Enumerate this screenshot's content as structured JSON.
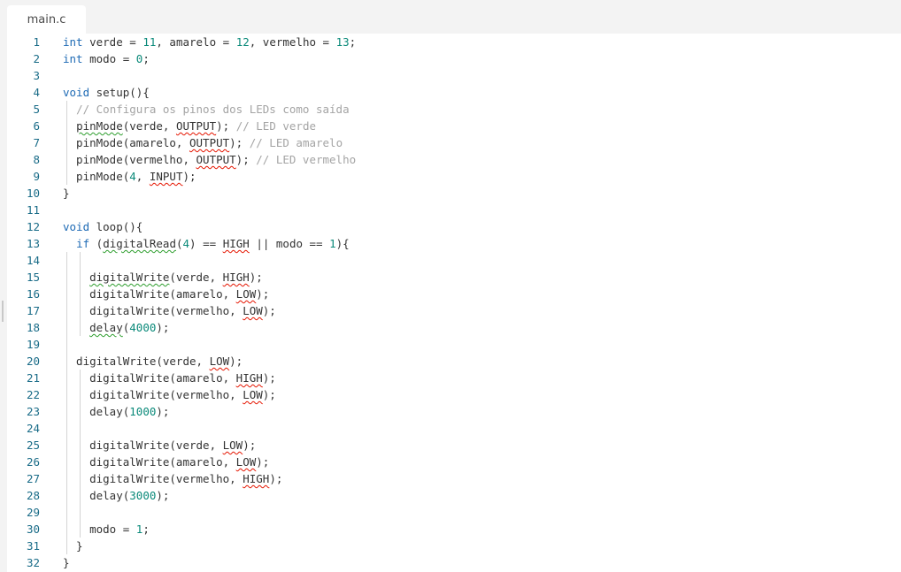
{
  "tab": {
    "label": "main.c"
  },
  "editor": {
    "lines": [
      {
        "n": "1",
        "tokens": [
          {
            "t": "int",
            "c": "kw"
          },
          {
            "t": " verde = "
          },
          {
            "t": "11",
            "c": "num"
          },
          {
            "t": ", amarelo = "
          },
          {
            "t": "12",
            "c": "num"
          },
          {
            "t": ", vermelho = "
          },
          {
            "t": "13",
            "c": "num"
          },
          {
            "t": ";"
          }
        ]
      },
      {
        "n": "2",
        "tokens": [
          {
            "t": "int",
            "c": "kw"
          },
          {
            "t": " modo = "
          },
          {
            "t": "0",
            "c": "num"
          },
          {
            "t": ";"
          }
        ]
      },
      {
        "n": "3",
        "tokens": []
      },
      {
        "n": "4",
        "tokens": [
          {
            "t": "void",
            "c": "kw"
          },
          {
            "t": " setup(){"
          }
        ]
      },
      {
        "n": "5",
        "tokens": [
          {
            "t": "  "
          },
          {
            "t": "// Configura os pinos dos LEDs como saída",
            "c": "cm"
          }
        ]
      },
      {
        "n": "6",
        "tokens": [
          {
            "t": "  "
          },
          {
            "t": "pinMode",
            "c": "sqg"
          },
          {
            "t": "(verde, "
          },
          {
            "t": "OUTPUT",
            "c": "sq"
          },
          {
            "t": "); "
          },
          {
            "t": "// LED verde",
            "c": "cm"
          }
        ]
      },
      {
        "n": "7",
        "tokens": [
          {
            "t": "  pinMode(amarelo, "
          },
          {
            "t": "OUTPUT",
            "c": "sq"
          },
          {
            "t": "); "
          },
          {
            "t": "// LED amarelo",
            "c": "cm"
          }
        ]
      },
      {
        "n": "8",
        "tokens": [
          {
            "t": "  pinMode(vermelho, "
          },
          {
            "t": "OUTPUT",
            "c": "sq"
          },
          {
            "t": "); "
          },
          {
            "t": "// LED vermelho",
            "c": "cm"
          }
        ]
      },
      {
        "n": "9",
        "tokens": [
          {
            "t": "  pinMode("
          },
          {
            "t": "4",
            "c": "num"
          },
          {
            "t": ", "
          },
          {
            "t": "INPUT",
            "c": "sq"
          },
          {
            "t": ");"
          }
        ]
      },
      {
        "n": "10",
        "tokens": [
          {
            "t": "}"
          }
        ]
      },
      {
        "n": "11",
        "tokens": []
      },
      {
        "n": "12",
        "tokens": [
          {
            "t": "void",
            "c": "kw"
          },
          {
            "t": " loop(){"
          }
        ]
      },
      {
        "n": "13",
        "tokens": [
          {
            "t": "  "
          },
          {
            "t": "if",
            "c": "kw"
          },
          {
            "t": " ("
          },
          {
            "t": "digitalRead",
            "c": "sqg"
          },
          {
            "t": "("
          },
          {
            "t": "4",
            "c": "num"
          },
          {
            "t": ") == "
          },
          {
            "t": "HIGH",
            "c": "sq"
          },
          {
            "t": " || modo == "
          },
          {
            "t": "1",
            "c": "num"
          },
          {
            "t": "){"
          }
        ]
      },
      {
        "n": "14",
        "tokens": []
      },
      {
        "n": "15",
        "tokens": [
          {
            "t": "    "
          },
          {
            "t": "digitalWrite",
            "c": "sqg"
          },
          {
            "t": "(verde, "
          },
          {
            "t": "HIGH",
            "c": "sq"
          },
          {
            "t": ");"
          }
        ]
      },
      {
        "n": "16",
        "tokens": [
          {
            "t": "    digitalWrite(amarelo, "
          },
          {
            "t": "LOW",
            "c": "sq"
          },
          {
            "t": ");"
          }
        ]
      },
      {
        "n": "17",
        "tokens": [
          {
            "t": "    digitalWrite(vermelho, "
          },
          {
            "t": "LOW",
            "c": "sq"
          },
          {
            "t": ");"
          }
        ]
      },
      {
        "n": "18",
        "tokens": [
          {
            "t": "    "
          },
          {
            "t": "delay",
            "c": "sqg"
          },
          {
            "t": "("
          },
          {
            "t": "4000",
            "c": "num"
          },
          {
            "t": ");"
          }
        ]
      },
      {
        "n": "19",
        "tokens": []
      },
      {
        "n": "20",
        "tokens": [
          {
            "t": "  digitalWrite(verde, "
          },
          {
            "t": "LOW",
            "c": "sq"
          },
          {
            "t": ");"
          }
        ]
      },
      {
        "n": "21",
        "tokens": [
          {
            "t": "    digitalWrite(amarelo, "
          },
          {
            "t": "HIGH",
            "c": "sq"
          },
          {
            "t": ");"
          }
        ]
      },
      {
        "n": "22",
        "tokens": [
          {
            "t": "    digitalWrite(vermelho, "
          },
          {
            "t": "LOW",
            "c": "sq"
          },
          {
            "t": ");"
          }
        ]
      },
      {
        "n": "23",
        "tokens": [
          {
            "t": "    delay("
          },
          {
            "t": "1000",
            "c": "num"
          },
          {
            "t": ");"
          }
        ]
      },
      {
        "n": "24",
        "tokens": []
      },
      {
        "n": "25",
        "tokens": [
          {
            "t": "    digitalWrite(verde, "
          },
          {
            "t": "LOW",
            "c": "sq"
          },
          {
            "t": ");"
          }
        ]
      },
      {
        "n": "26",
        "tokens": [
          {
            "t": "    digitalWrite(amarelo, "
          },
          {
            "t": "LOW",
            "c": "sq"
          },
          {
            "t": ");"
          }
        ]
      },
      {
        "n": "27",
        "tokens": [
          {
            "t": "    digitalWrite(vermelho, "
          },
          {
            "t": "HIGH",
            "c": "sq"
          },
          {
            "t": ");"
          }
        ]
      },
      {
        "n": "28",
        "tokens": [
          {
            "t": "    delay("
          },
          {
            "t": "3000",
            "c": "num"
          },
          {
            "t": ");"
          }
        ]
      },
      {
        "n": "29",
        "tokens": []
      },
      {
        "n": "30",
        "tokens": [
          {
            "t": "    modo = "
          },
          {
            "t": "1",
            "c": "num"
          },
          {
            "t": ";"
          }
        ]
      },
      {
        "n": "31",
        "tokens": [
          {
            "t": "  }"
          }
        ]
      },
      {
        "n": "32",
        "tokens": [
          {
            "t": "}"
          }
        ]
      }
    ]
  },
  "colors": {
    "keyword": "#1f6bb5",
    "number": "#0b8a7a",
    "comment": "#a4a4a4",
    "line_number": "#1a6c88",
    "error_squiggle": "#e51400",
    "warning_squiggle": "#2e9e2e"
  }
}
